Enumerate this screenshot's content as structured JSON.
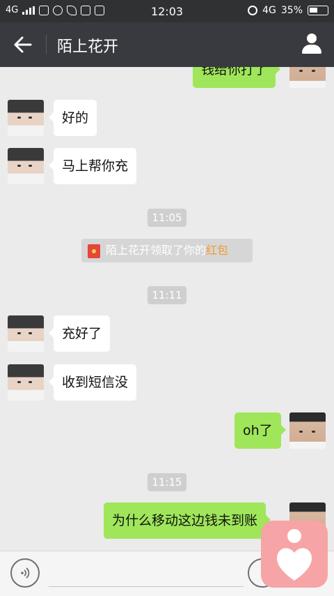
{
  "status_bar": {
    "network": "4G",
    "time": "12:03",
    "network_right": "4G",
    "battery": "35%"
  },
  "header": {
    "back_icon": "arrow-left",
    "title": "陌上花开",
    "profile_icon": "person"
  },
  "messages": [
    {
      "side": "right",
      "text": "钱给你打了"
    },
    {
      "side": "left",
      "text": "好的"
    },
    {
      "side": "left",
      "text": "马上帮你充"
    },
    {
      "type": "time",
      "text": "11:05"
    },
    {
      "type": "system",
      "text": "陌上花开领取了你的",
      "highlight": "红包",
      "highlight_color": "#f39a34"
    },
    {
      "type": "time",
      "text": "11:11"
    },
    {
      "side": "left",
      "text": "充好了"
    },
    {
      "side": "left",
      "text": "收到短信没"
    },
    {
      "side": "right",
      "text": "oh了"
    },
    {
      "type": "time",
      "text": "11:15"
    },
    {
      "side": "right",
      "text": "为什么移动这边钱未到账"
    }
  ],
  "colors": {
    "outgoing_bubble": "#9fe65a",
    "incoming_bubble": "#ffffff",
    "header_bg": "#393a3f"
  },
  "input_bar": {
    "voice_icon": "voice",
    "emoji_icon": "emoji"
  }
}
